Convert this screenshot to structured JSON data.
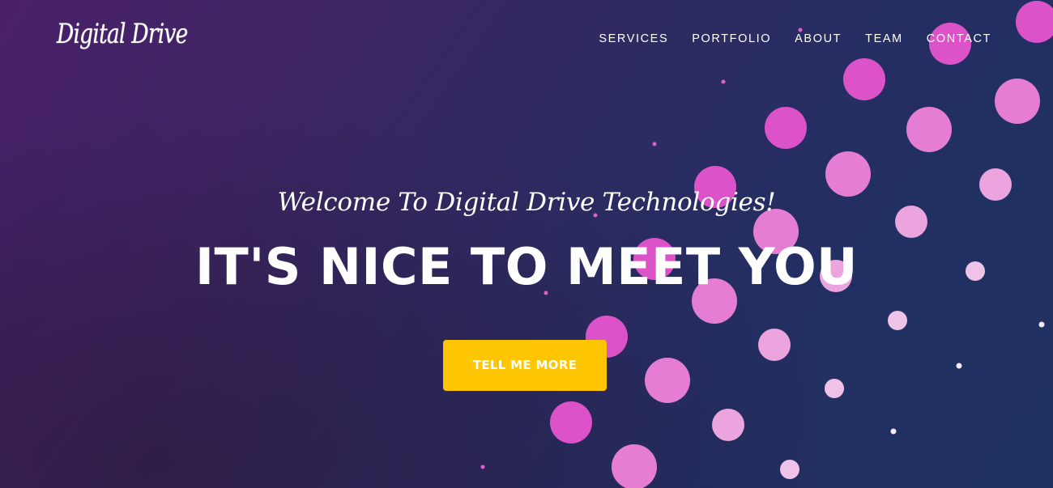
{
  "brand": {
    "logo_text": "Digital Drive"
  },
  "nav": {
    "items": [
      {
        "label": "SERVICES"
      },
      {
        "label": "PORTFOLIO"
      },
      {
        "label": "ABOUT"
      },
      {
        "label": "TEAM"
      },
      {
        "label": "CONTACT"
      }
    ]
  },
  "hero": {
    "welcome_text": "Welcome To Digital Drive Technologies!",
    "headline": "IT'S NICE TO MEET YOU",
    "cta_label": "TELL ME MORE"
  },
  "colors": {
    "cta_background": "#fec503",
    "bubble_magenta": "#dd50c8",
    "bubble_pink": "#e67fd4",
    "bubble_light": "#edb8e2"
  }
}
